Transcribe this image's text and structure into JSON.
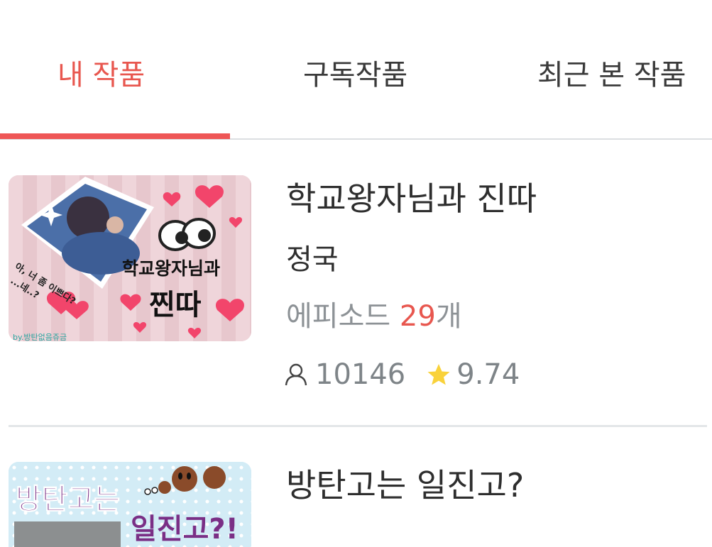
{
  "tabs": [
    {
      "label": "내 작품",
      "active": true
    },
    {
      "label": "구독작품",
      "active": false
    },
    {
      "label": "최근 본 작품",
      "active": false
    }
  ],
  "accent_color": "#e8574f",
  "works": [
    {
      "title": "학교왕자님과 진따",
      "author": "정국",
      "episodes_label": "에피소드 ",
      "episodes_count": "29",
      "episodes_unit": "개",
      "views": "10146",
      "rating": "9.74",
      "thumb_text": {
        "title_top": "학교왕자님과",
        "title_bottom": "찐따",
        "bubble": "아, 너 좀 이쁘다?",
        "bubble2": "...네..?",
        "credit": "by.방탄없음쥬금"
      }
    },
    {
      "title": "방탄고는 일진고?",
      "thumb_text": {
        "line1": "방탄고는",
        "line2": "일진고?!"
      }
    }
  ],
  "icons": {
    "views": "person-icon",
    "rating": "star-icon"
  }
}
